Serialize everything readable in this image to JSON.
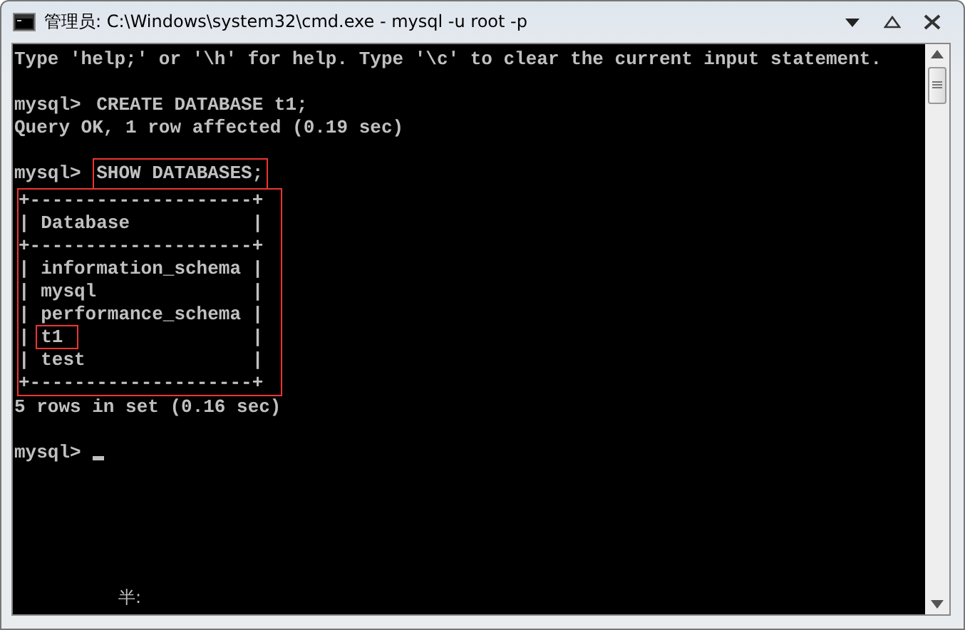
{
  "window": {
    "title": "管理员: C:\\Windows\\system32\\cmd.exe - mysql  -u root -p"
  },
  "console": {
    "lines": [
      {
        "kind": "text",
        "text": "Type 'help;' or '\\h' for help. Type '\\c' to clear the current input statement."
      },
      {
        "kind": "blank"
      },
      {
        "kind": "prompt",
        "prompt": "mysql>",
        "command": "CREATE DATABASE t1;"
      },
      {
        "kind": "text",
        "text": "Query OK, 1 row affected (0.19 sec)"
      },
      {
        "kind": "blank"
      },
      {
        "kind": "prompt",
        "prompt": "mysql>",
        "command": "SHOW DATABASES;",
        "highlighted": true
      },
      {
        "kind": "table",
        "highlighted": true,
        "border": "+--------------------+",
        "edge": "|",
        "header": "Database",
        "rows": [
          {
            "text": "information_schema"
          },
          {
            "text": "mysql"
          },
          {
            "text": "performance_schema"
          },
          {
            "text": "t1",
            "highlighted": true
          },
          {
            "text": "test"
          }
        ]
      },
      {
        "kind": "text",
        "text": "5 rows in set (0.16 sec)"
      },
      {
        "kind": "blank"
      },
      {
        "kind": "prompt",
        "prompt": "mysql>",
        "cursor": true
      }
    ],
    "ime_status": "半:"
  }
}
